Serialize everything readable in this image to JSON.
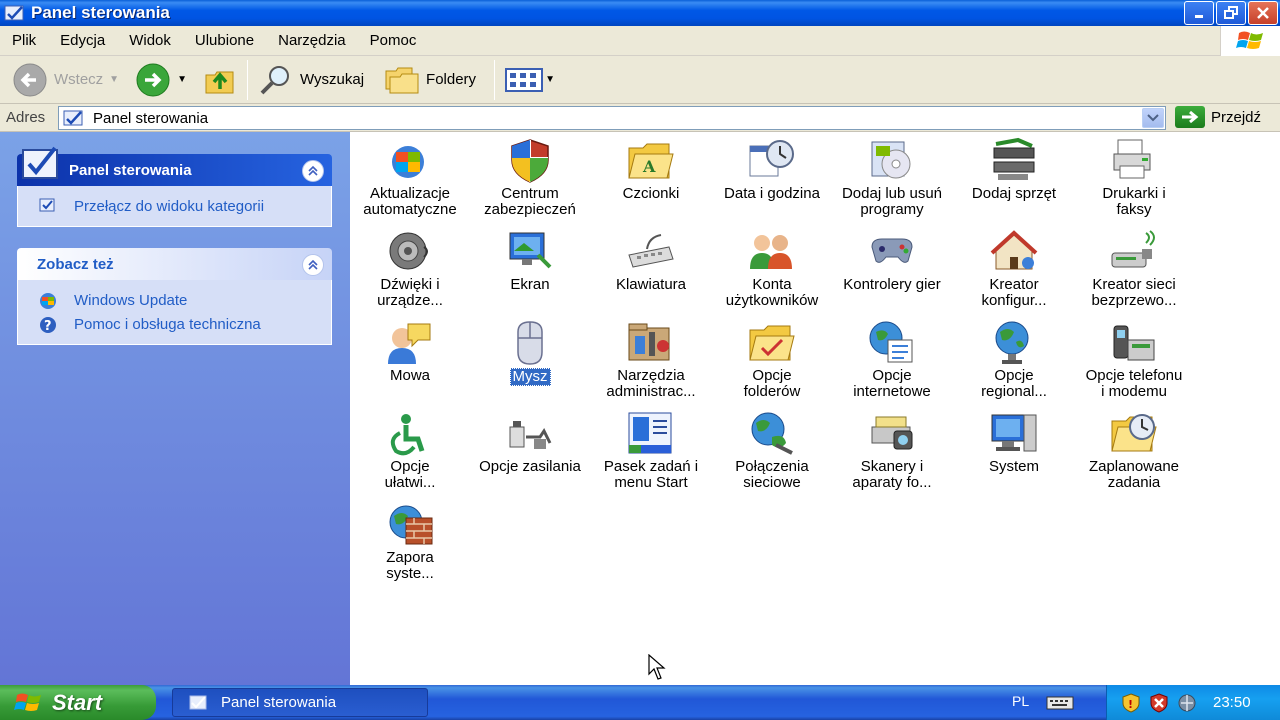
{
  "window": {
    "title": "Panel sterowania"
  },
  "menubar": {
    "items": [
      "Plik",
      "Edycja",
      "Widok",
      "Ulubione",
      "Narzędzia",
      "Pomoc"
    ]
  },
  "toolbar": {
    "back": "Wstecz",
    "search": "Wyszukaj",
    "folders": "Foldery"
  },
  "address": {
    "label": "Adres",
    "value": "Panel sterowania",
    "go": "Przejdź"
  },
  "taskpane": {
    "panel": {
      "title": "Panel sterowania",
      "links": [
        "Przełącz do widoku kategorii"
      ]
    },
    "seealso": {
      "title": "Zobacz też",
      "links": [
        "Windows Update",
        "Pomoc i obsługa techniczna"
      ]
    }
  },
  "icons": [
    [
      "Aktualizacje",
      "automatyczne"
    ],
    [
      "Centrum",
      "zabezpieczeń"
    ],
    [
      "Czcionki",
      ""
    ],
    [
      "Data i godzina",
      ""
    ],
    [
      "Dodaj lub usuń",
      "programy"
    ],
    [
      "Dodaj sprzęt",
      ""
    ],
    [
      "Drukarki i",
      "faksy"
    ],
    [
      "Dźwięki i",
      "urządze..."
    ],
    [
      "Ekran",
      ""
    ],
    [
      "Klawiatura",
      ""
    ],
    [
      "Konta",
      "użytkowników"
    ],
    [
      "Kontrolery gier",
      ""
    ],
    [
      "Kreator",
      "konfigur..."
    ],
    [
      "Kreator sieci",
      "bezprzewo..."
    ],
    [
      "Mowa",
      ""
    ],
    [
      "Mysz",
      ""
    ],
    [
      "Narzędzia",
      "administrac..."
    ],
    [
      "Opcje",
      "folderów"
    ],
    [
      "Opcje",
      "internetowe"
    ],
    [
      "Opcje",
      "regional..."
    ],
    [
      "Opcje telefonu",
      "i modemu"
    ],
    [
      "Opcje",
      "ułatwi..."
    ],
    [
      "Opcje zasilania",
      ""
    ],
    [
      "Pasek zadań i",
      "menu Start"
    ],
    [
      "Połączenia",
      "sieciowe"
    ],
    [
      "Skanery i",
      "aparaty fo..."
    ],
    [
      "System",
      ""
    ],
    [
      "Zaplanowane",
      "zadania"
    ],
    [
      "Zapora",
      "syste..."
    ]
  ],
  "selected_icon": "Mysz",
  "taskbar": {
    "start": "Start",
    "task": "Panel sterowania",
    "lang": "PL",
    "clock": "23:50"
  },
  "colors": {
    "titlebar": "#0054e3",
    "taskpane": "#6f8fe0",
    "selection": "#316ac5",
    "link": "#215dc6"
  }
}
